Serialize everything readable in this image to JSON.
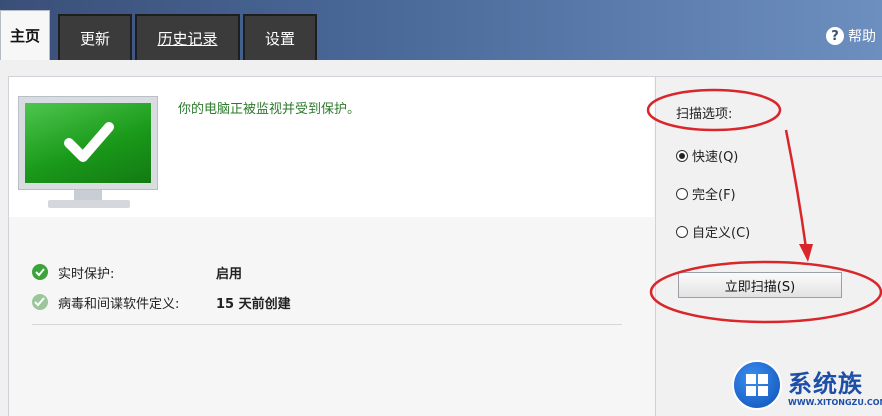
{
  "tabs": [
    {
      "label": "主页"
    },
    {
      "label": "更新"
    },
    {
      "label": "历史记录"
    },
    {
      "label": "设置"
    }
  ],
  "help": {
    "label": "帮助"
  },
  "status": {
    "message": "你的电脑正被监视并受到保护。"
  },
  "protection_rows": [
    {
      "label": "实时保护:",
      "value": "启用"
    },
    {
      "label": "病毒和间谍软件定义:",
      "value": "15 天前创建"
    }
  ],
  "scan": {
    "title": "扫描选项:",
    "options": [
      {
        "label": "快速(Q)",
        "selected": true
      },
      {
        "label": "完全(F)",
        "selected": false
      },
      {
        "label": "自定义(C)",
        "selected": false
      }
    ],
    "button_label": "立即扫描(S)"
  },
  "watermark": {
    "title": "系统族",
    "url": "WWW.XITONGZU.COM"
  },
  "colors": {
    "accent_green": "#2d7a2d",
    "annotation_red": "#d9262a",
    "header_blue": "#4a6a9a"
  }
}
